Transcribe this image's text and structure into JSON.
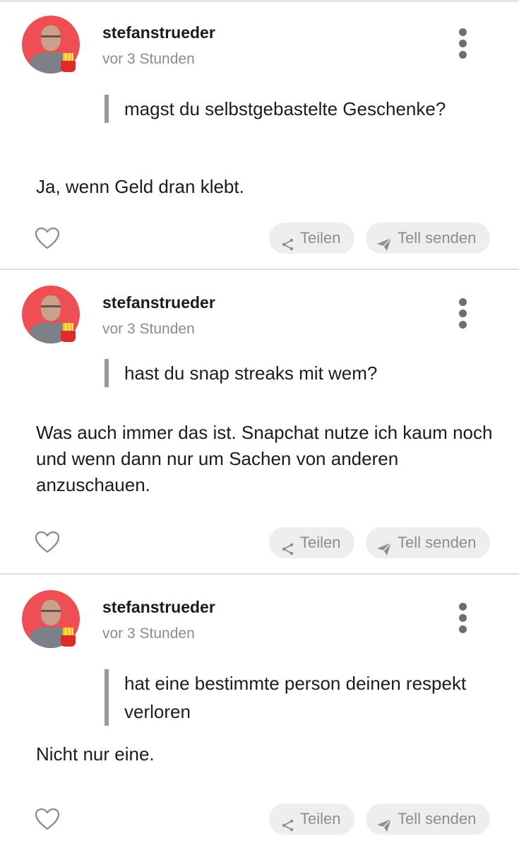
{
  "posts": [
    {
      "username": "stefanstrueder",
      "time": "vor 3 Stunden",
      "question": "magst du selbstgebastelte Geschenke?",
      "answer": "Ja, wenn Geld dran klebt.",
      "share_label": "Teilen",
      "tell_label": "Tell senden"
    },
    {
      "username": "stefanstrueder",
      "time": "vor 3 Stunden",
      "question": "hast du snap streaks mit wem?",
      "answer": "Was auch immer das ist. Snapchat nutze ich kaum noch und wenn dann nur um Sachen von anderen anzuschauen.",
      "share_label": "Teilen",
      "tell_label": "Tell senden"
    },
    {
      "username": "stefanstrueder",
      "time": "vor 3 Stunden",
      "question": "hat eine bestimmte person deinen respekt verloren",
      "answer": "Nicht nur eine.",
      "share_label": "Teilen",
      "tell_label": "Tell senden"
    }
  ],
  "icons": {
    "avatar_badge": "fries-icon",
    "like": "heart-outline-icon",
    "share": "share-icon",
    "tell": "paper-plane-icon",
    "more": "more-vertical-icon"
  },
  "colors": {
    "avatar_bg": "#ee4f55",
    "pill_bg": "#eeeeee",
    "muted_text": "#8b8b8b",
    "quote_bar": "#9a9a9a"
  }
}
